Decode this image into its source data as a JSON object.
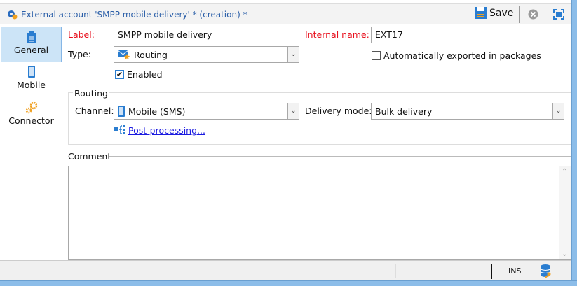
{
  "window": {
    "title": "External account 'SMPP mobile delivery' * (creation) *",
    "save_label": "Save"
  },
  "sidebar": {
    "items": [
      {
        "label": "General",
        "icon": "clipboard-icon"
      },
      {
        "label": "Mobile",
        "icon": "mobile-icon"
      },
      {
        "label": "Connector",
        "icon": "gears-icon"
      }
    ]
  },
  "form": {
    "label_label": "Label:",
    "label_value": "SMPP mobile delivery",
    "internal_name_label": "Internal name:",
    "internal_name_value": "EXT17",
    "type_label": "Type:",
    "type_value": "Routing",
    "auto_export_label": "Automatically exported in packages",
    "auto_export_checked": false,
    "enabled_label": "Enabled",
    "enabled_checked": true
  },
  "routing": {
    "title": "Routing",
    "channel_label": "Channel:",
    "channel_value": "Mobile (SMS)",
    "delivery_mode_label": "Delivery mode:",
    "delivery_mode_value": "Bulk delivery",
    "post_processing_link": "Post-processing..."
  },
  "comment": {
    "label": "Comment",
    "value": ""
  },
  "statusbar": {
    "mode": "INS"
  },
  "colors": {
    "accent": "#2a5ea8",
    "required": "#e8101d",
    "selected_tab": "#cce4f7",
    "border": "#8cbde9"
  }
}
